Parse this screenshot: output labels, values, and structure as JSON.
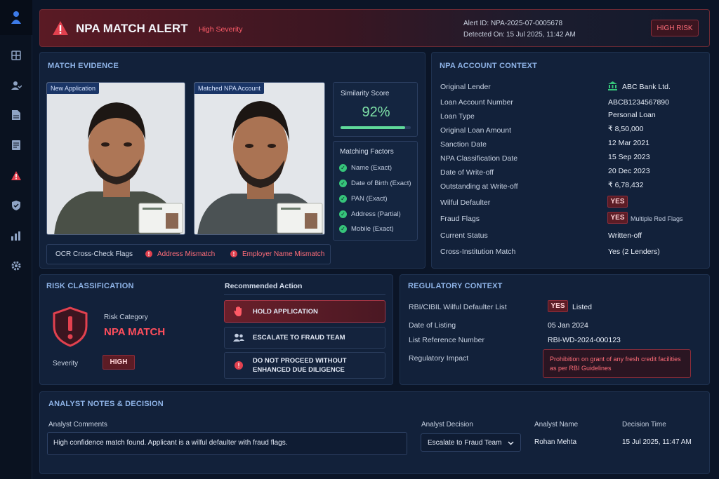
{
  "colors": {
    "accent": "#8fb4e8",
    "danger": "#e2414f",
    "success": "#36c47a",
    "bg": "#0b1527"
  },
  "sidebar": {
    "items": [
      "dashboard-icon",
      "user-check-icon",
      "document-icon",
      "list-document-icon",
      "alert-triangle-icon",
      "shield-check-icon",
      "bar-chart-icon",
      "settings-icon"
    ]
  },
  "alert": {
    "title": "NPA MATCH ALERT",
    "severity": "High Severity",
    "alert_id_label": "Alert ID:",
    "alert_id": "NPA-2025-07-0005678",
    "detected_label": "Detected On:",
    "detected_on": "15 Jul 2025, 11:42 AM",
    "risk_button": "HIGH RISK"
  },
  "evidence": {
    "title": "MATCH EVIDENCE",
    "new_app_tag": "New Application",
    "matched_tag": "Matched NPA Account",
    "similarity_label": "Similarity Score",
    "similarity": "92%",
    "similarity_value": 0.92,
    "factors_title": "Matching Factors",
    "factors": [
      "Name (Exact)",
      "Date of Birth (Exact)",
      "PAN (Exact)",
      "Address (Partial)",
      "Mobile (Exact)"
    ],
    "ocr_label": "OCR Cross-Check Flags",
    "ocr_flags": [
      "Address Mismatch",
      "Employer Name Mismatch"
    ]
  },
  "context": {
    "title": "NPA ACCOUNT CONTEXT",
    "rows": [
      {
        "label": "Original Lender",
        "value": "ABC Bank Ltd."
      },
      {
        "label": "Loan Account Number",
        "value": "ABCB1234567890"
      },
      {
        "label": "Loan Type",
        "value": "Personal Loan"
      },
      {
        "label": "Original Loan Amount",
        "value": "₹ 8,50,000"
      },
      {
        "label": "Sanction Date",
        "value": "12 Mar 2021"
      },
      {
        "label": "NPA Classification Date",
        "value": "15 Sep 2023"
      },
      {
        "label": "Date of Write-off",
        "value": "20 Dec 2023"
      },
      {
        "label": "Outstanding at Write-off",
        "value": "₹ 6,78,432"
      },
      {
        "label": "Wilful Defaulter",
        "value": "YES"
      },
      {
        "label": "Fraud Flags",
        "value": "YES",
        "note": "Multiple Red Flags"
      },
      {
        "label": "Current Status",
        "value": "Written-off"
      },
      {
        "label": "Cross-Institution Match",
        "value": "Yes (2 Lenders)"
      }
    ]
  },
  "risk": {
    "title": "RISK CLASSIFICATION",
    "category_label": "Risk Category",
    "category": "NPA MATCH",
    "severity_label": "Severity",
    "severity": "HIGH"
  },
  "actions": {
    "title": "Recommended Action",
    "items": [
      "HOLD APPLICATION",
      "ESCALATE TO FRAUD TEAM",
      "DO NOT PROCEED WITHOUT",
      "ENHANCED DUE DILIGENCE"
    ]
  },
  "regulatory": {
    "title": "REGULATORY CONTEXT",
    "list_label": "RBI/CIBIL Wilful Defaulter List",
    "list_badge": "YES",
    "list_value": "Listed",
    "date_label": "Date of Listing",
    "date": "05 Jan 2024",
    "ref_label": "List Reference Number",
    "ref": "RBI-WD-2024-000123",
    "impact_label": "Regulatory Impact",
    "impact_line1": "Prohibition on grant of any fresh credit facilities",
    "impact_line2": "as per RBI Guidelines"
  },
  "notes": {
    "title": "ANALYST NOTES & DECISION",
    "comments_label": "Analyst Comments",
    "comments": "High confidence match found. Applicant is a wilful defaulter with fraud flags.",
    "decision_label": "Analyst Decision",
    "decision": "Escalate to Fraud Team",
    "name_label": "Analyst Name",
    "name": "Rohan Mehta",
    "time_label": "Decision Time",
    "time": "15 Jul 2025, 11:47 AM"
  }
}
